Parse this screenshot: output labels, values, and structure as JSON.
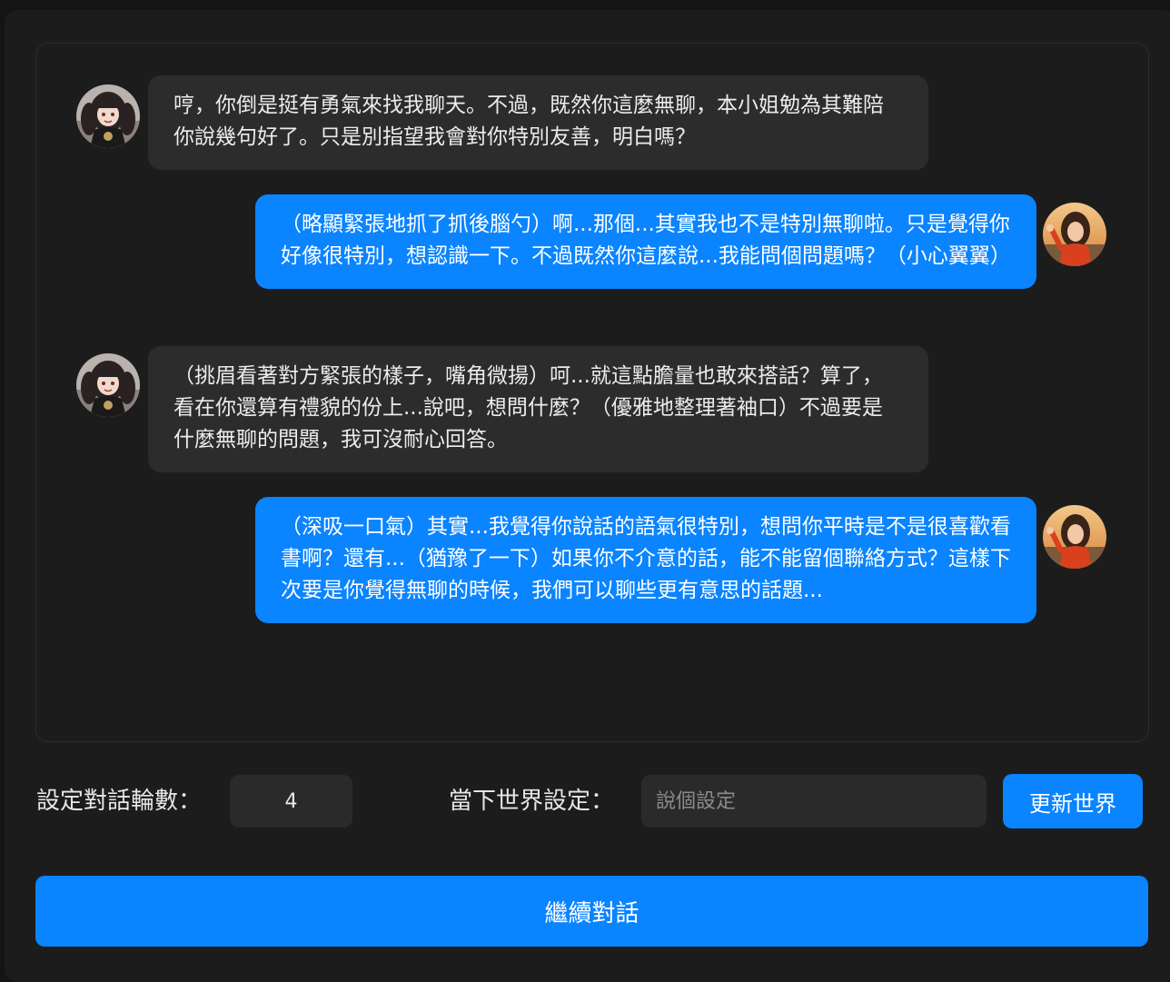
{
  "messages": [
    {
      "role": "bot",
      "avatar": "bot-avatar-icon",
      "text": "哼，你倒是挺有勇氣來找我聊天。不過，既然你這麼無聊，本小姐勉為其難陪你說幾句好了。只是別指望我會對你特別友善，明白嗎？"
    },
    {
      "role": "user",
      "avatar": "user-avatar-icon",
      "text": "（略顯緊張地抓了抓後腦勺）啊...那個...其實我也不是特別無聊啦。只是覺得你好像很特別，想認識一下。不過既然你這麼說...我能問個問題嗎？（小心翼翼）"
    },
    {
      "role": "bot",
      "avatar": "bot-avatar-icon",
      "text": "（挑眉看著對方緊張的樣子，嘴角微揚）呵...就這點膽量也敢來搭話？算了，看在你還算有禮貌的份上...說吧，想問什麼？（優雅地整理著袖口）不過要是什麼無聊的問題，我可沒耐心回答。"
    },
    {
      "role": "user",
      "avatar": "user-avatar-icon",
      "text": "（深吸一口氣）其實...我覺得你說話的語氣很特別，想問你平時是不是很喜歡看書啊？還有...（猶豫了一下）如果你不介意的話，能不能留個聯絡方式？這樣下次要是你覺得無聊的時候，我們可以聊些更有意思的話題..."
    }
  ],
  "controls": {
    "rounds_label": "設定對話輪數：",
    "rounds_value": "4",
    "world_label": "當下世界設定：",
    "world_placeholder": "說個設定",
    "world_value": "",
    "update_button": "更新世界",
    "continue_button": "繼續對話"
  },
  "colors": {
    "background": "#1c1c1c",
    "bot_bubble": "#2c2c2c",
    "user_bubble": "#0a84ff",
    "accent": "#0a84ff"
  }
}
